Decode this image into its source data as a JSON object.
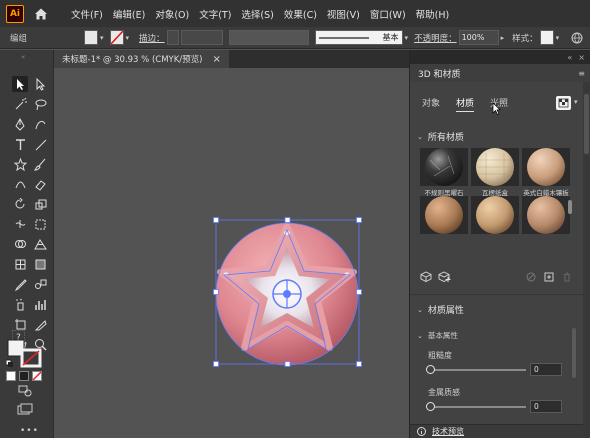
{
  "app": {
    "logo_text": "Ai",
    "menu": [
      "文件(F)",
      "编辑(E)",
      "对象(O)",
      "文字(T)",
      "选择(S)",
      "效果(C)",
      "视图(V)",
      "窗口(W)",
      "帮助(H)"
    ]
  },
  "control_bar": {
    "group_label": "编组",
    "stroke_label": "描边：",
    "stroke_style": "基本",
    "opacity_label": "不透明度：",
    "opacity_value": "100%",
    "style_label": "样式："
  },
  "document_tab": {
    "title": "未标题-1* @ 30.93 % (CMYK/预览)",
    "close": "×"
  },
  "panel": {
    "title": "3D 和材质",
    "tabs": [
      "对象",
      "材质",
      "光照"
    ],
    "active_tab": "材质",
    "all_materials_label": "所有材质",
    "materials": [
      {
        "label": "不规则黑曜石",
        "color": "#2a2a2a"
      },
      {
        "label": "瓦楞纸盒",
        "color": "#d9c7a6"
      },
      {
        "label": "英式白蜡木镶板",
        "color": "#c9a587"
      },
      {
        "label": "",
        "color": "#a87b5a"
      },
      {
        "label": "",
        "color": "#c49a74"
      },
      {
        "label": "",
        "color": "#b68a69"
      }
    ],
    "material_properties_label": "材质属性",
    "basic_props_label": "基本属性",
    "roughness_label": "粗糙度",
    "roughness_value": "0",
    "metallic_label": "金属质感",
    "metallic_value": "0",
    "footer_label": "技术预览"
  },
  "colors": {
    "accent": "#ff9a00",
    "selection": "#4a6cff",
    "shape_main": "#e0868f"
  }
}
